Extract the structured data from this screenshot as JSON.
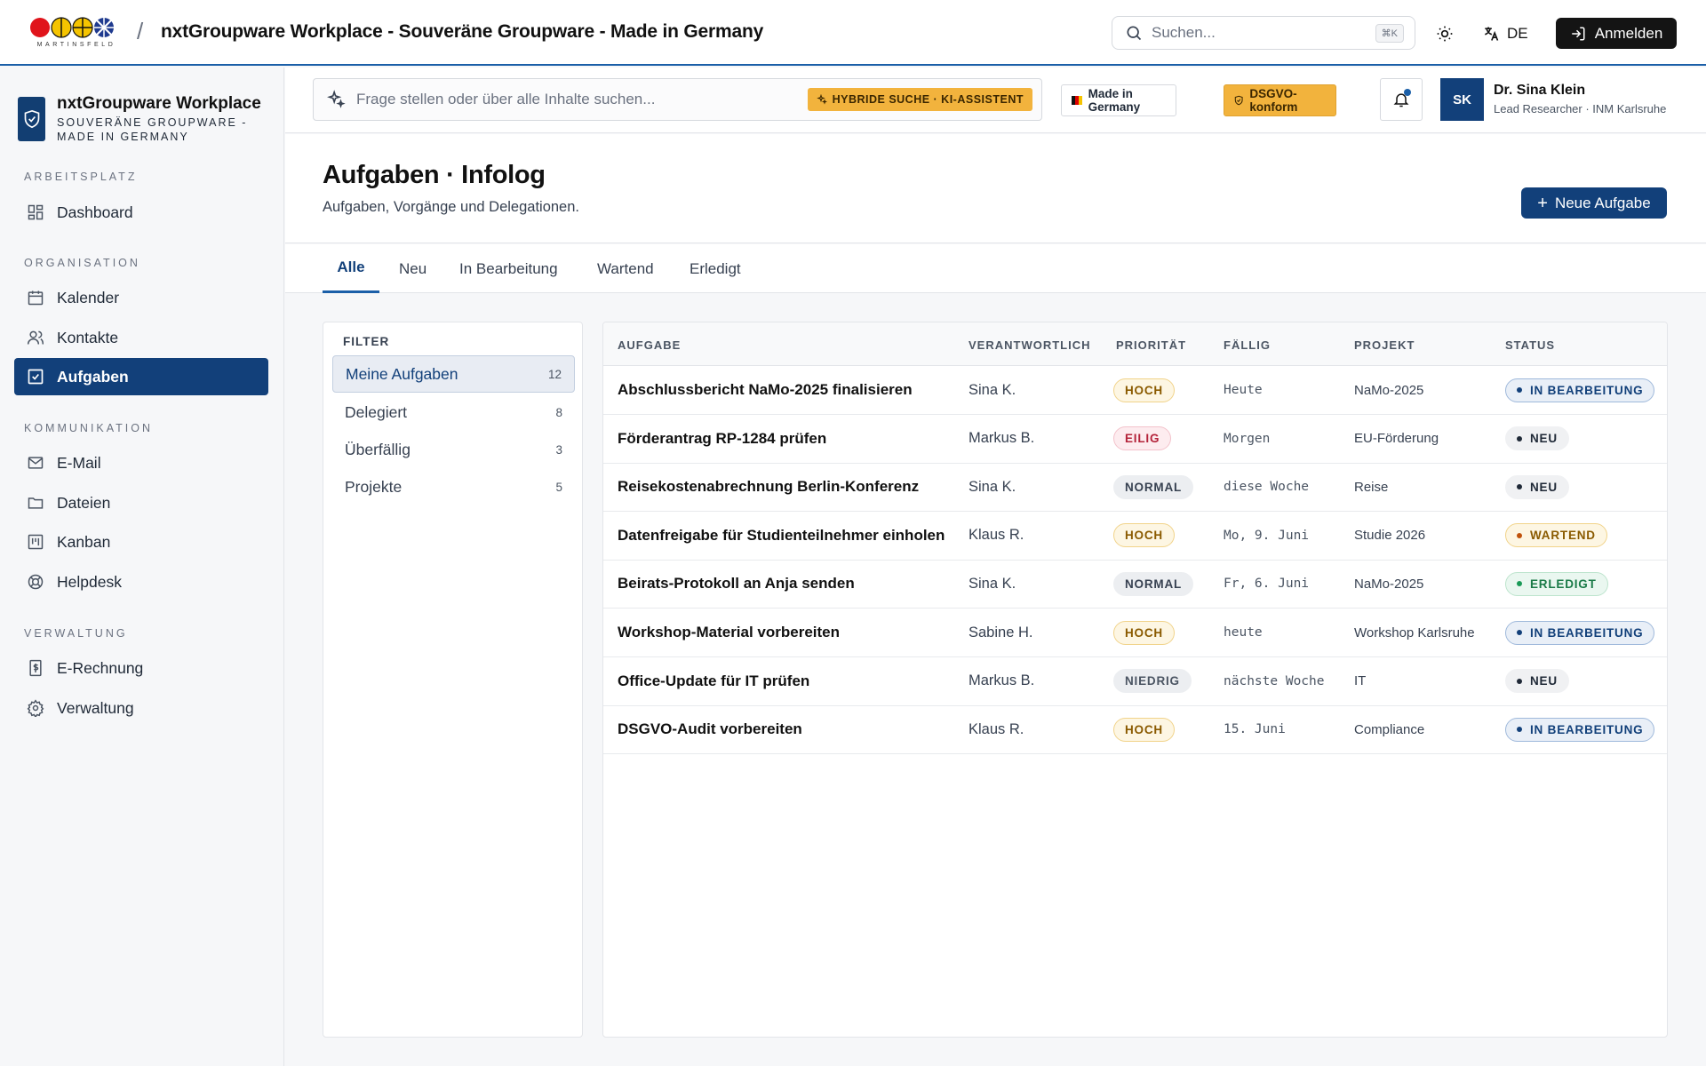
{
  "header": {
    "logo_text": "MARTINSFELD",
    "separator": "/",
    "title": "nxtGroupware Workplace - Souveräne Groupware - Made in Germany",
    "search_placeholder": "Suchen...",
    "search_shortcut": "⌘K",
    "language": "DE",
    "login_label": "Anmelden"
  },
  "sidebar": {
    "brand_name": "nxtGroupware Workplace",
    "brand_sub": "SOUVERÄNE GROUPWARE - MADE IN GERMANY",
    "sections": [
      {
        "label": "ARBEITSPLATZ",
        "items": [
          {
            "label": "Dashboard",
            "icon": "dashboard-icon"
          }
        ]
      },
      {
        "label": "ORGANISATION",
        "items": [
          {
            "label": "Kalender",
            "icon": "calendar-icon"
          },
          {
            "label": "Kontakte",
            "icon": "contacts-icon"
          },
          {
            "label": "Aufgaben",
            "icon": "tasks-icon",
            "active": true
          }
        ]
      },
      {
        "label": "KOMMUNIKATION",
        "items": [
          {
            "label": "E-Mail",
            "icon": "mail-icon"
          },
          {
            "label": "Dateien",
            "icon": "folder-icon"
          },
          {
            "label": "Kanban",
            "icon": "kanban-icon"
          },
          {
            "label": "Helpdesk",
            "icon": "helpdesk-icon"
          }
        ]
      },
      {
        "label": "VERWALTUNG",
        "items": [
          {
            "label": "E-Rechnung",
            "icon": "invoice-icon"
          },
          {
            "label": "Verwaltung",
            "icon": "gear-icon"
          }
        ]
      }
    ]
  },
  "toolbar": {
    "ai_search_placeholder": "Frage stellen oder über alle Inhalte suchen...",
    "ai_badge": "HYBRIDE SUCHE · KI-ASSISTENT",
    "made_in_germany": "Made in Germany",
    "dsgvo": "DSGVO-konform",
    "user_initials": "SK",
    "user_name": "Dr. Sina Klein",
    "user_role": "Lead Researcher · INM Karlsruhe"
  },
  "page": {
    "title": "Aufgaben · Infolog",
    "subtitle": "Aufgaben, Vorgänge und Delegationen.",
    "new_button": "Neue Aufgabe",
    "tabs": [
      "Alle",
      "Neu",
      "In Bearbeitung",
      "Wartend",
      "Erledigt"
    ],
    "active_tab": "Alle"
  },
  "filter": {
    "title": "FILTER",
    "items": [
      {
        "label": "Meine Aufgaben",
        "count": "12",
        "active": true
      },
      {
        "label": "Delegiert",
        "count": "8"
      },
      {
        "label": "Überfällig",
        "count": "3"
      },
      {
        "label": "Projekte",
        "count": "5"
      }
    ]
  },
  "table": {
    "columns": [
      "AUFGABE",
      "VERANTWORTLICH",
      "PRIORITÄT",
      "FÄLLIG",
      "PROJEKT",
      "STATUS"
    ],
    "rows": [
      {
        "task": "Abschlussbericht NaMo-2025 finalisieren",
        "owner": "Sina K.",
        "priority": "HOCH",
        "due": "Heute",
        "project": "NaMo-2025",
        "status": "IN BEARBEITUNG"
      },
      {
        "task": "Förderantrag RP-1284 prüfen",
        "owner": "Markus B.",
        "priority": "EILIG",
        "due": "Morgen",
        "project": "EU-Förderung",
        "status": "NEU"
      },
      {
        "task": "Reisekostenabrechnung Berlin-Konferenz",
        "owner": "Sina K.",
        "priority": "NORMAL",
        "due": "diese Woche",
        "project": "Reise",
        "status": "NEU"
      },
      {
        "task": "Datenfreigabe für Studienteilnehmer einholen",
        "owner": "Klaus R.",
        "priority": "HOCH",
        "due": "Mo, 9. Juni",
        "project": "Studie 2026",
        "status": "WARTEND"
      },
      {
        "task": "Beirats-Protokoll an Anja senden",
        "owner": "Sina K.",
        "priority": "NORMAL",
        "due": "Fr, 6. Juni",
        "project": "NaMo-2025",
        "status": "ERLEDIGT"
      },
      {
        "task": "Workshop-Material vorbereiten",
        "owner": "Sabine H.",
        "priority": "HOCH",
        "due": "heute",
        "project": "Workshop Karlsruhe",
        "status": "IN BEARBEITUNG"
      },
      {
        "task": "Office-Update für IT prüfen",
        "owner": "Markus B.",
        "priority": "NIEDRIG",
        "due": "nächste Woche",
        "project": "IT",
        "status": "NEU"
      },
      {
        "task": "DSGVO-Audit vorbereiten",
        "owner": "Klaus R.",
        "priority": "HOCH",
        "due": "15. Juni",
        "project": "Compliance",
        "status": "IN BEARBEITUNG"
      }
    ]
  },
  "colors": {
    "primary": "#12407a",
    "accent": "#f2b33d",
    "topbar_border": "#1b5fa8"
  }
}
